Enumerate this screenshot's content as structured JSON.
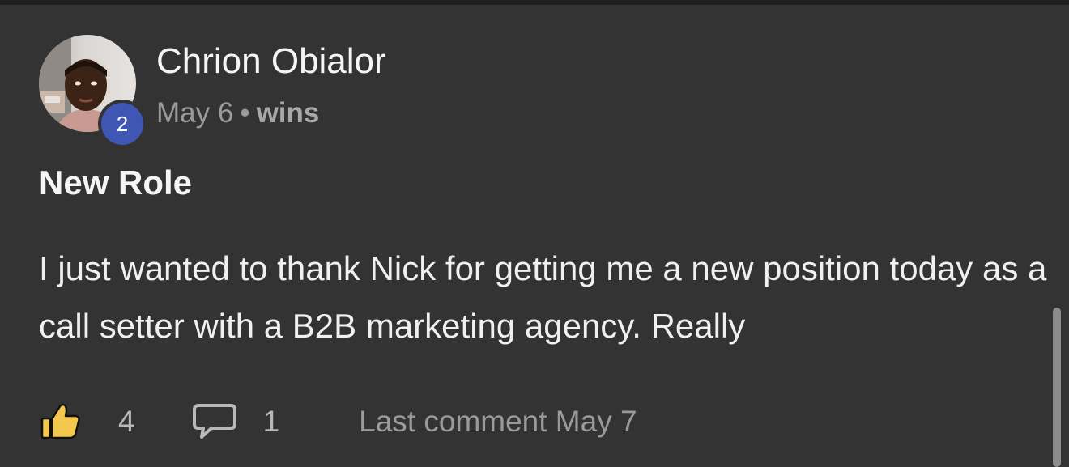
{
  "post": {
    "author": {
      "name": "Chrion Obialor",
      "avatar_icon": "user-photo-avatar",
      "level": "2",
      "level_color": "#3f56b5"
    },
    "meta": {
      "date": "May 6",
      "separator": "•",
      "category": "wins"
    },
    "title": "New Role",
    "body": "I just wanted to thank Nick for getting me a new position today as a call setter with a B2B marketing agency. Really",
    "footer": {
      "like_icon": "thumbs-up-icon",
      "like_icon_color": "#f2c94c",
      "likes": "4",
      "comment_icon": "comment-bubble-icon",
      "comments": "1",
      "last_comment": "Last comment May 7"
    }
  },
  "colors": {
    "background": "#333333",
    "text_primary": "#f5f5f5",
    "text_secondary": "#9a9a9a"
  }
}
